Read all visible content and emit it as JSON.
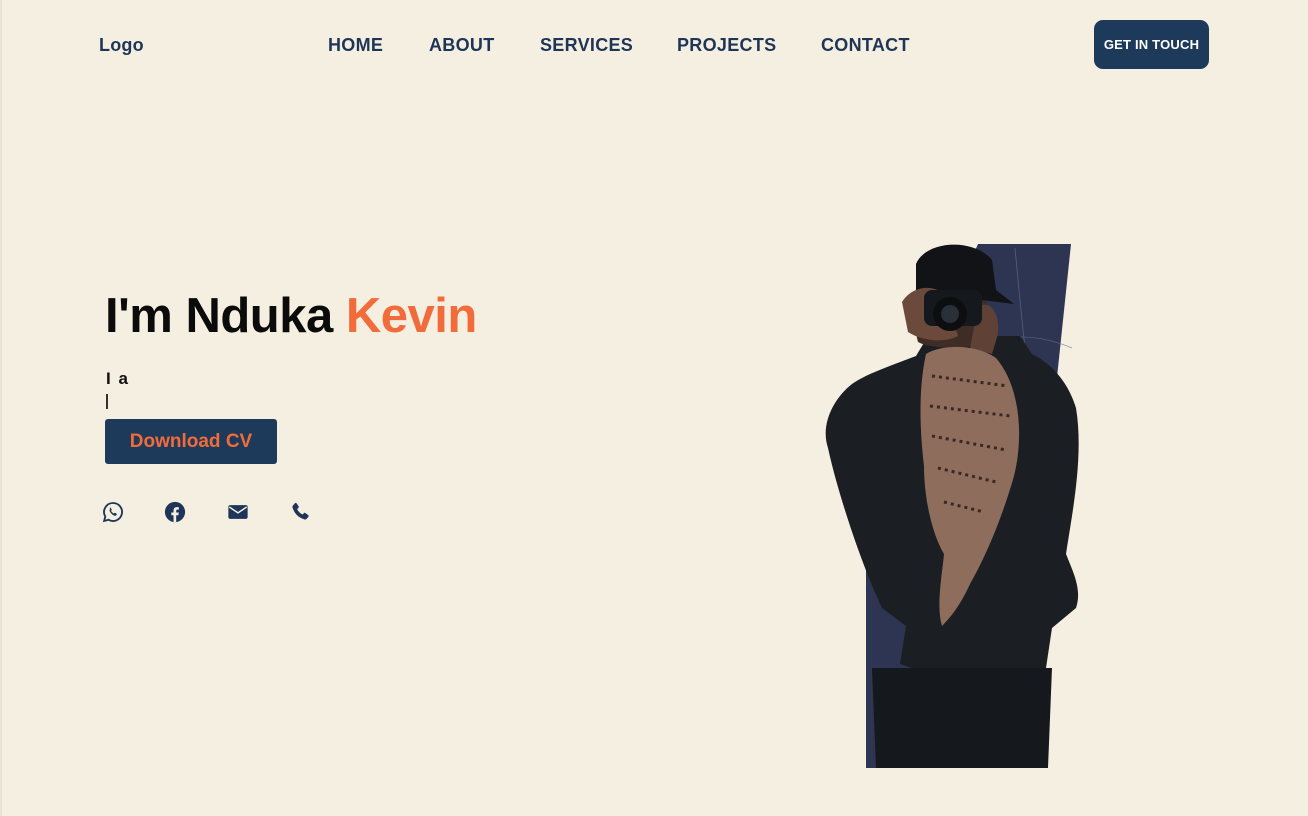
{
  "header": {
    "logo": "Logo",
    "nav": [
      "HOME",
      "ABOUT",
      "SERVICES",
      "PROJECTS",
      "CONTACT"
    ],
    "cta_label": "GET IN TOUCH"
  },
  "hero": {
    "title_prefix": "I'm Nduka ",
    "title_accent": "Kevin",
    "role_text": "I a",
    "download_label": "Download CV",
    "socials": [
      "whatsapp-icon",
      "facebook-icon",
      "mail-icon",
      "phone-icon"
    ]
  },
  "colors": {
    "background": "#f5efe1",
    "navy": "#1e3a5b",
    "accent": "#f26b3a"
  }
}
